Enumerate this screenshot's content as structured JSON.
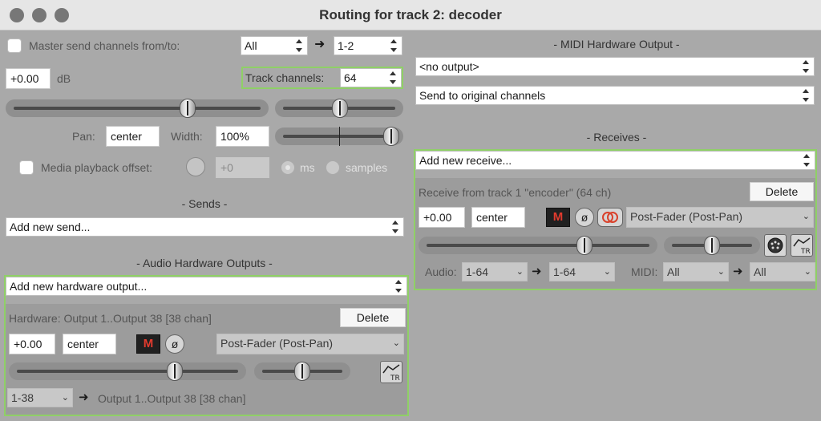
{
  "window": {
    "title": "Routing for track 2: decoder"
  },
  "master_send": {
    "label": "Master send channels from/to:",
    "from": "All",
    "to": "1-2",
    "volume": "+0.00",
    "volume_unit": "dB",
    "track_channels_label": "Track channels:",
    "track_channels": "64",
    "pan_label": "Pan:",
    "pan": "center",
    "width_label": "Width:",
    "width": "100%",
    "media_offset_label": "Media playback offset:",
    "media_offset_value": "+0",
    "unit_ms": "ms",
    "unit_samples": "samples"
  },
  "sends": {
    "header": "- Sends -",
    "add": "Add new send..."
  },
  "hw_outputs": {
    "header": "- Audio Hardware Outputs -",
    "add": "Add new hardware output...",
    "item": {
      "title": "Hardware: Output 1..Output 38 [38 chan]",
      "delete": "Delete",
      "volume": "+0.00",
      "pan": "center",
      "mute": "M",
      "phase": "ø",
      "mode": "Post-Fader (Post-Pan)",
      "channels": "1-38",
      "dest": "Output 1..Output 38 [38 chan]",
      "arrow": "➜"
    }
  },
  "midi_hw": {
    "header": "- MIDI Hardware Output -",
    "output": "<no output>",
    "channels": "Send to original channels"
  },
  "receives": {
    "header": "- Receives -",
    "add": "Add new receive...",
    "item": {
      "title": "Receive from track 1 \"encoder\" (64 ch)",
      "delete": "Delete",
      "volume": "+0.00",
      "pan": "center",
      "mute": "M",
      "phase": "ø",
      "mode": "Post-Fader (Post-Pan)",
      "audio_label": "Audio:",
      "audio_from": "1-64",
      "audio_to": "1-64",
      "midi_label": "MIDI:",
      "midi_from": "All",
      "midi_to": "All",
      "arrow": "➜"
    }
  }
}
